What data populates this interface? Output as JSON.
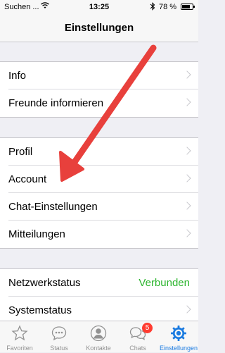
{
  "status_bar": {
    "carrier": "Suchen ...",
    "time": "13:25",
    "battery_percent_label": "78 %",
    "battery_level": 0.78
  },
  "nav": {
    "title": "Einstellungen"
  },
  "groups": [
    {
      "rows": [
        {
          "label": "Info"
        },
        {
          "label": "Freunde informieren"
        }
      ]
    },
    {
      "rows": [
        {
          "label": "Profil"
        },
        {
          "label": "Account"
        },
        {
          "label": "Chat-Einstellungen"
        },
        {
          "label": "Mitteilungen"
        }
      ]
    },
    {
      "rows": [
        {
          "label": "Netzwerkstatus",
          "value": "Verbunden"
        },
        {
          "label": "Systemstatus"
        }
      ]
    }
  ],
  "tabs": [
    {
      "label": "Favoriten",
      "icon": "star-icon"
    },
    {
      "label": "Status",
      "icon": "speech-bubble-dots-icon"
    },
    {
      "label": "Kontakte",
      "icon": "person-icon"
    },
    {
      "label": "Chats",
      "icon": "chat-bubbles-icon",
      "badge": "5"
    },
    {
      "label": "Einstellungen",
      "icon": "gear-icon",
      "active": true
    }
  ],
  "colors": {
    "accent": "#1b7be0",
    "connected": "#2db52f",
    "badge": "#ff3b30",
    "annotation_arrow": "#e8403c"
  }
}
